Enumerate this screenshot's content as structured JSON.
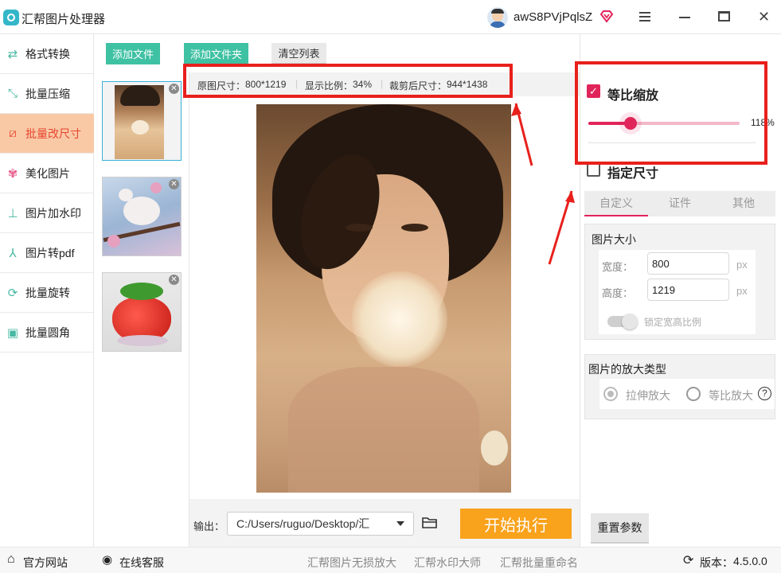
{
  "app": {
    "title": "汇帮图片处理器",
    "username": "awS8PVjPqlsZ"
  },
  "sidebar": {
    "items": [
      {
        "label": "格式转换",
        "icon": "format-convert-icon"
      },
      {
        "label": "批量压缩",
        "icon": "compress-icon"
      },
      {
        "label": "批量改尺寸",
        "icon": "resize-icon",
        "active": true
      },
      {
        "label": "美化图片",
        "icon": "beautify-icon"
      },
      {
        "label": "图片加水印",
        "icon": "watermark-icon"
      },
      {
        "label": "图片转pdf",
        "icon": "pdf-icon"
      },
      {
        "label": "批量旋转",
        "icon": "rotate-icon"
      },
      {
        "label": "批量圆角",
        "icon": "round-corner-icon"
      }
    ]
  },
  "toolbar": {
    "add_file": "添加文件",
    "add_folder": "添加文件夹",
    "clear_list": "清空列表"
  },
  "info": {
    "original_label": "原图尺寸：",
    "original_value": "800*1219",
    "scale_label": "显示比例：",
    "scale_value": "34%",
    "cropped_label": "裁剪后尺寸：",
    "cropped_value": "944*1438"
  },
  "output": {
    "label": "输出：",
    "path": "C:/Users/ruguo/Desktop/汇",
    "start_button": "开始执行"
  },
  "right": {
    "proportional_label": "等比缩放",
    "slider_value": "118%",
    "slider_fraction": 0.28,
    "specified_size_label": "指定尺寸",
    "tabs": [
      "自定义",
      "证件",
      "其他"
    ],
    "image_size_title": "图片大小",
    "width_label": "宽度：",
    "width_value": "800",
    "width_unit": "px",
    "height_label": "高度：",
    "height_value": "1219",
    "height_unit": "px",
    "lock_ratio_label": "锁定宽高比例",
    "enlarge_title": "图片的放大类型",
    "stretch_label": "拉伸放大",
    "proportional_enlarge_label": "等比放大",
    "reset_button": "重置参数"
  },
  "status": {
    "website": "官方网站",
    "support": "在线客服",
    "link1": "汇帮图片无损放大",
    "link2": "汇帮水印大师",
    "link3": "汇帮批量重命名",
    "version_label": "版本：",
    "version": "4.5.0.0"
  },
  "colors": {
    "accent_green": "#3fc1a3",
    "accent_orange": "#f9a21b",
    "accent_pink": "#e0255a",
    "highlight_red": "#e8201c"
  }
}
